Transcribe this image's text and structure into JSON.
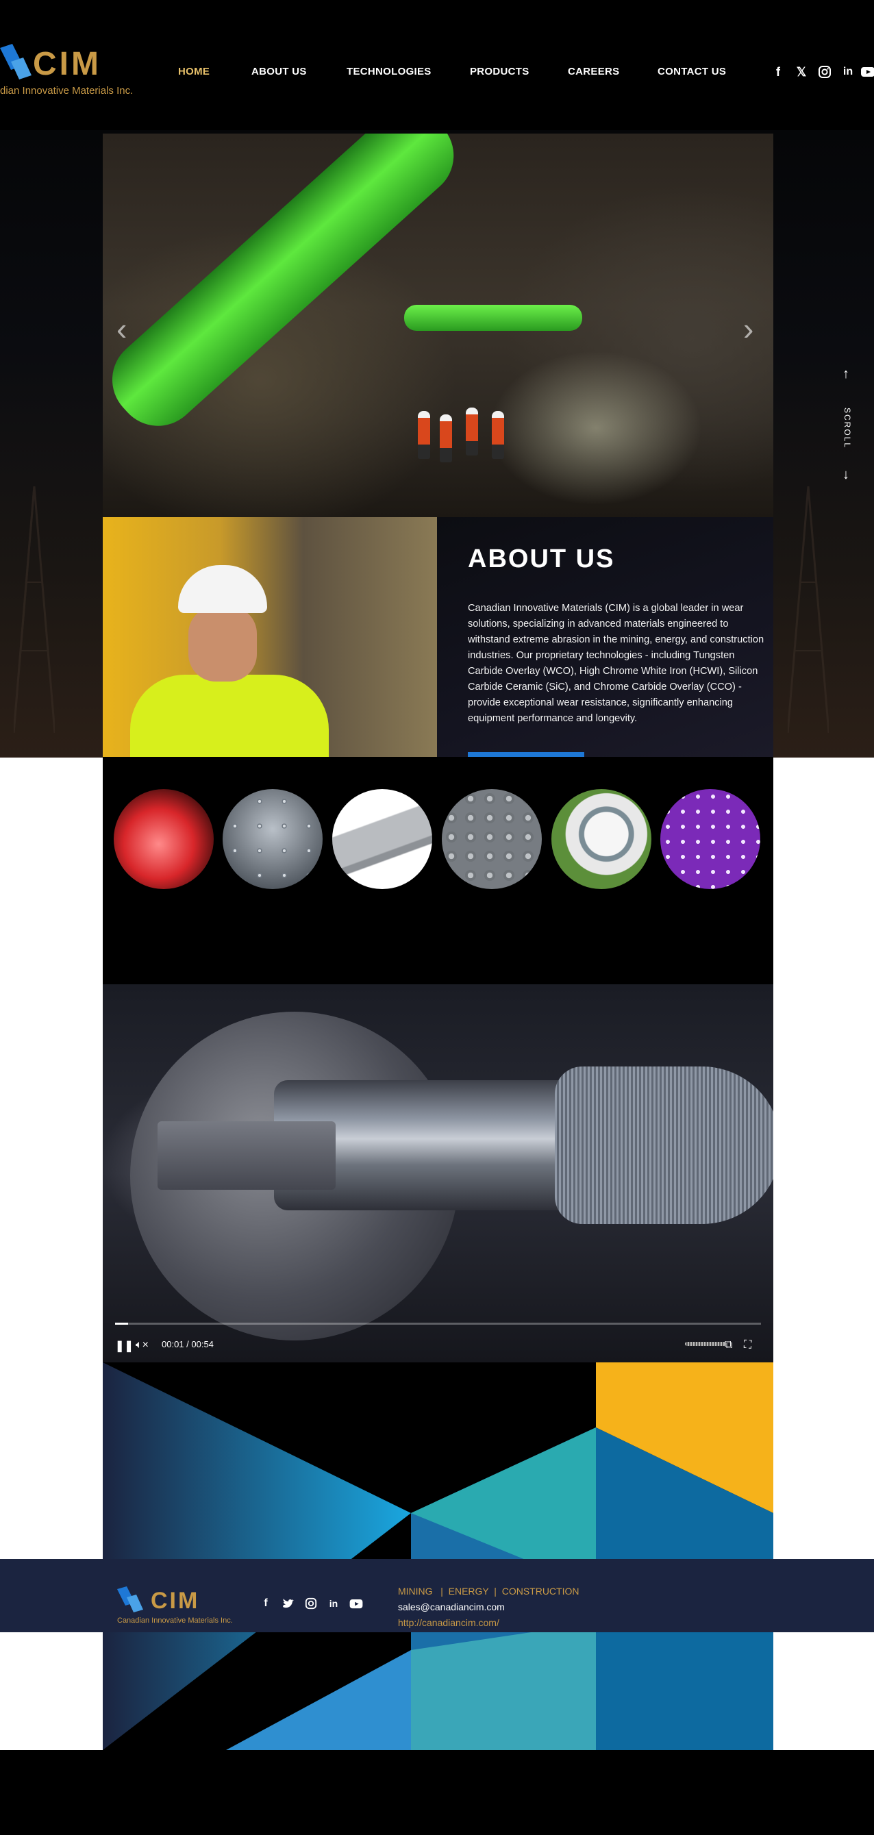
{
  "brand": {
    "logo_text": "CIM",
    "tagline": "Canadian Innovative Materials Inc.",
    "tagline_header_visible": "dian Innovative Materials Inc.",
    "gold": "#c99a46",
    "blue": "#1e78d6"
  },
  "nav": {
    "items": [
      {
        "label": "HOME",
        "active": true
      },
      {
        "label": "ABOUT US",
        "active": false
      },
      {
        "label": "TECHNOLOGIES",
        "active": false
      },
      {
        "label": "PRODUCTS",
        "active": false
      },
      {
        "label": "CAREERS",
        "active": false
      },
      {
        "label": "CONTACT US",
        "active": false
      }
    ],
    "active_color": "#e8c16a"
  },
  "social_icons": [
    "facebook-icon",
    "x-icon",
    "instagram-icon",
    "linkedin-icon",
    "youtube-icon"
  ],
  "hero": {
    "prev_arrow": "‹",
    "next_arrow": "›",
    "scroll_label": "SCROLL"
  },
  "about": {
    "title": "ABOUT US",
    "body": "Canadian Innovative Materials (CIM) is a global leader  in wear solutions, specializing in advanced materials engineered to withstand extreme abrasion in the mining, energy, and construction industries. Our proprietary technologies - including Tungsten Carbide Overlay (WCO), High Chrome White Iron (HCWI), Silicon Carbide Ceramic (SiC), and Chrome Carbide Overlay (CCO) - provide exceptional wear resistance, significantly enhancing equipment performance and longevity."
  },
  "products": {
    "circles": [
      {
        "name": "product-circle-heated-blocks"
      },
      {
        "name": "product-circle-carbide-studs"
      },
      {
        "name": "product-circle-plates"
      },
      {
        "name": "product-circle-textured-overlay"
      },
      {
        "name": "product-circle-ceramic-elbow"
      },
      {
        "name": "product-circle-purple-studded"
      }
    ]
  },
  "video": {
    "time": "00:01 / 00:54",
    "progress": 0.02
  },
  "footer": {
    "tags": "MINING   |  ENERGY  |  CONSTRUCTION",
    "email": "sales@canadiancim.com",
    "url": "http://canadiancim.com/"
  }
}
